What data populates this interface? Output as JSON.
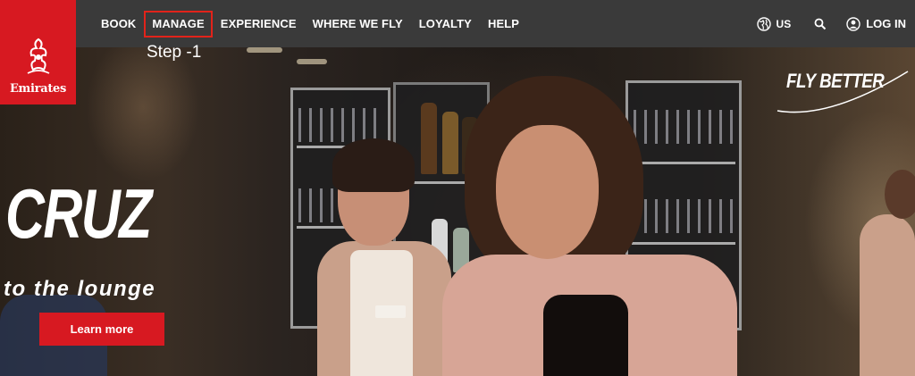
{
  "brand": {
    "name": "Emirates",
    "color": "#d71921"
  },
  "nav": {
    "items": [
      {
        "label": "BOOK"
      },
      {
        "label": "MANAGE"
      },
      {
        "label": "EXPERIENCE"
      },
      {
        "label": "WHERE WE FLY"
      },
      {
        "label": "LOYALTY"
      },
      {
        "label": "HELP"
      }
    ],
    "region": "US",
    "login_label": "LOG IN"
  },
  "annotation": {
    "step_label": "Step -1",
    "highlight_color": "#e2231a"
  },
  "hero": {
    "title": "CRUZ",
    "subtitle": "to the lounge",
    "cta_label": "Learn more",
    "tagline": "FLY BETTER"
  },
  "icons": {
    "globe": "globe-icon",
    "search": "search-icon",
    "user": "user-icon"
  }
}
